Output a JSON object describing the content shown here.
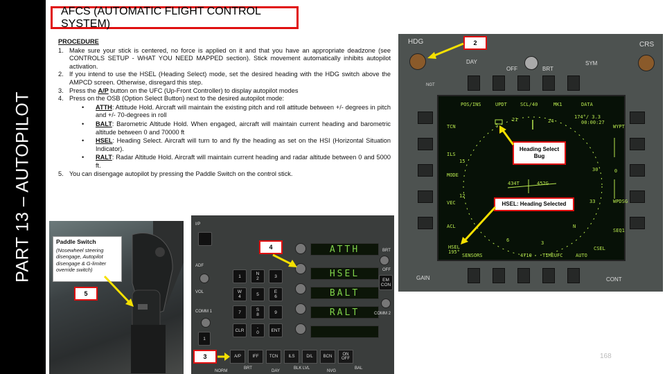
{
  "sidebar": {
    "title": "PART 13 – AUTOPILOT"
  },
  "header": {
    "title": "AFCS (AUTOMATIC FLIGHT CONTROL SYSTEM)"
  },
  "procedure": {
    "heading": "PROCEDURE",
    "steps": [
      {
        "num": "1.",
        "text": "Make sure your stick is centered, no force is applied on it and that you have an appropriate deadzone (see CONTROLS SETUP - WHAT YOU NEED MAPPED section). Stick movement automatically inhibits autopilot activation."
      },
      {
        "num": "2.",
        "text": "If you intend to use the HSEL (Heading Select) mode, set the desired heading with the HDG switch above the AMPCD screen. Otherwise, disregard this step."
      },
      {
        "num": "3.",
        "pre": "Press the ",
        "key": "A/P",
        "post": " button on the UFC (Up-Front Controller) to display autopilot modes"
      },
      {
        "num": "4.",
        "text": "Press on the OSB (Option Select Button) next to the desired autopilot mode:"
      }
    ],
    "modes": [
      {
        "key": "ATTH",
        "text": ": Attitude Hold. Aircraft will maintain the existing pitch and roll attitude between +/- degrees in pitch and +/- 70-degrees in roll"
      },
      {
        "key": "BALT",
        "text": ": Barometric Altitude Hold. When engaged, aircraft will maintain current heading and barometric altitude between 0 and 70000 ft"
      },
      {
        "key": "HSEL",
        "text": ": Heading Select. Aircraft will turn to and fly the heading as set on the HSI (Horizontal Situation Indicator)."
      },
      {
        "key": "RALT",
        "text": ": Radar Altitude Hold. Aircraft will maintain current heading and radar altitude between 0 and 5000 ft."
      }
    ],
    "step5": {
      "num": "5.",
      "text": "You can disengage autopilot by pressing the Paddle Switch on the control stick."
    },
    "bullet": "•"
  },
  "paddle": {
    "title": "Paddle Switch",
    "desc": "(Nosewheel steering disengage, Autopilot disengage & G-limiter override switch)",
    "callout": "5"
  },
  "ufc": {
    "callout_4": "4",
    "callout_3": "3",
    "options": [
      "ATTH",
      "HSEL",
      "BALT",
      "RALT"
    ],
    "labels": {
      "ip": "I/P",
      "adf": "ADF",
      "vol": "VOL",
      "comm1": "COMM 1",
      "comm2": "COMM 2",
      "brt": "BRT",
      "em_con": "EM CON",
      "off": "OFF",
      "num_one": "1"
    },
    "keypad": [
      "1",
      "N\n2",
      "3",
      "W\n4",
      "5",
      "E\n6",
      "7",
      "S\n8",
      "9",
      "CLR",
      "-\n0",
      "ENT"
    ],
    "function_keys": [
      "A/P",
      "IFF",
      "TCN",
      "ILS",
      "D/L",
      "BCN",
      "ON\nOFF"
    ],
    "bottom_labels": [
      "NORM",
      "BRT",
      "DAY",
      "BLK LVL",
      "NVG",
      "BAL"
    ]
  },
  "mfd": {
    "callout_2": "2",
    "heading_bug_callout": "Heading Select Bug",
    "hsel_callout": "HSEL: Heading Selected",
    "bezel": {
      "hdg": "HDG",
      "crs": "CRS",
      "day": "DAY",
      "night": "NGT",
      "off": "OFF",
      "brt": "BRT",
      "sym": "SYM",
      "gain": "GAIN",
      "cont": "CONT"
    },
    "top_labels": [
      "POS/INS",
      "UPDT",
      "SCL/40",
      "MK1",
      "DATA"
    ],
    "bottom_labels": [
      "SENSORS",
      "4710",
      "TIMEUFC",
      "AUTO"
    ],
    "left_labels": [
      "TCN",
      "ILS",
      "MODE",
      "VEC",
      "ACL"
    ],
    "right_labels": [
      "WYPT",
      "0",
      "WPDSG",
      "SEQ1"
    ],
    "compass": [
      "21",
      "24",
      "15",
      "30",
      "12",
      "33",
      "6",
      "3",
      "S",
      "N"
    ],
    "readouts": {
      "time": "174°/ 3.3",
      "clock": "00:00:27",
      "speed": "434T",
      "hdg_sel": "452G",
      "hsel": "HSEL",
      "hsel_val": "195°",
      "csel": "CSEL"
    }
  },
  "page_number": "168",
  "colors": {
    "accent_red": "#e01010",
    "mfd_green": "#b7e74e",
    "ufc_green": "#7fd24a"
  }
}
